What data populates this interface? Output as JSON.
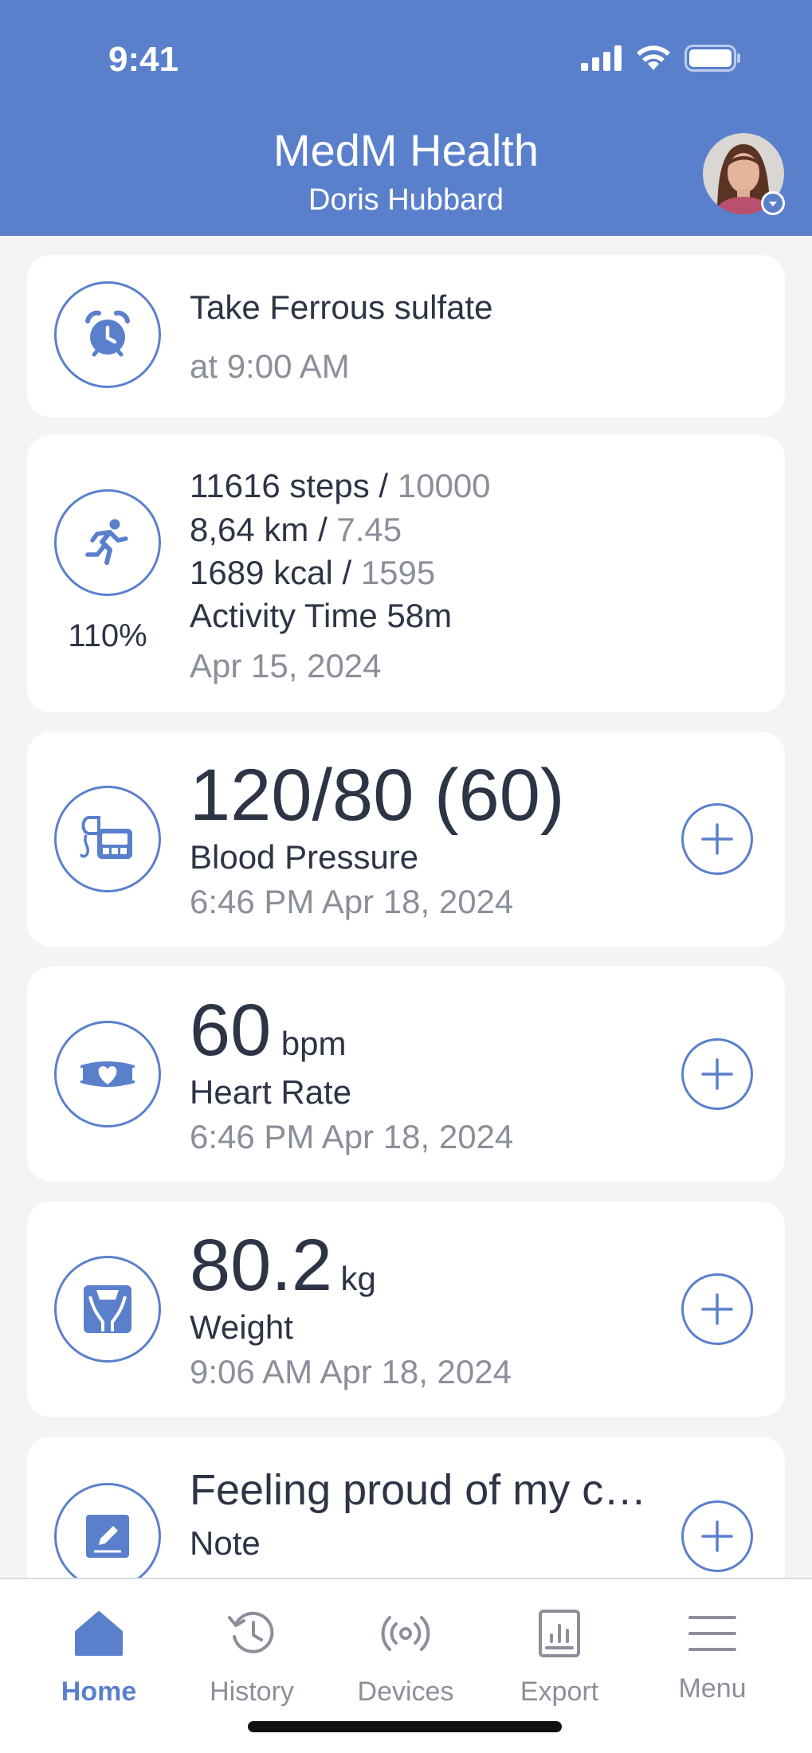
{
  "status_bar": {
    "time": "9:41"
  },
  "header": {
    "title": "MedM Health",
    "subtitle": "Doris Hubbard"
  },
  "reminder": {
    "title": "Take Ferrous sulfate",
    "time": "at 9:00 AM",
    "icon": "alarm-clock-icon"
  },
  "activity": {
    "steps": "11616 steps / ",
    "steps_goal": "10000",
    "distance": "8,64 km / ",
    "distance_goal": "7.45",
    "kcal": "1689 kcal / ",
    "kcal_goal": "1595",
    "activity_time": "Activity Time 58m",
    "date": "Apr 15, 2024",
    "percent": "110%",
    "icon": "running-person-icon"
  },
  "blood_pressure": {
    "value": "120/80 (60)",
    "label": "Blood Pressure",
    "date": "6:46 PM Apr 18, 2024",
    "icon": "blood-pressure-monitor-icon"
  },
  "heart_rate": {
    "value": "60",
    "unit": "bpm",
    "label": "Heart Rate",
    "date": "6:46 PM Apr 18, 2024",
    "icon": "heart-strap-icon"
  },
  "weight": {
    "value": "80.2",
    "unit": "kg",
    "label": "Weight",
    "date": "9:06 AM Apr 18, 2024",
    "icon": "scale-icon"
  },
  "note": {
    "value": "Feeling proud of my c…",
    "label": "Note",
    "icon": "note-pencil-icon"
  },
  "tabs": [
    {
      "label": "Home",
      "icon": "home-icon",
      "active": true
    },
    {
      "label": "History",
      "icon": "history-icon"
    },
    {
      "label": "Devices",
      "icon": "devices-icon"
    },
    {
      "label": "Export",
      "icon": "export-icon"
    },
    {
      "label": "Menu",
      "icon": "menu-icon"
    }
  ],
  "colors": {
    "accent": "#5a80cc",
    "text": "#2d3446",
    "secondary_text": "#8a8f99",
    "background": "#f4f4f6"
  }
}
